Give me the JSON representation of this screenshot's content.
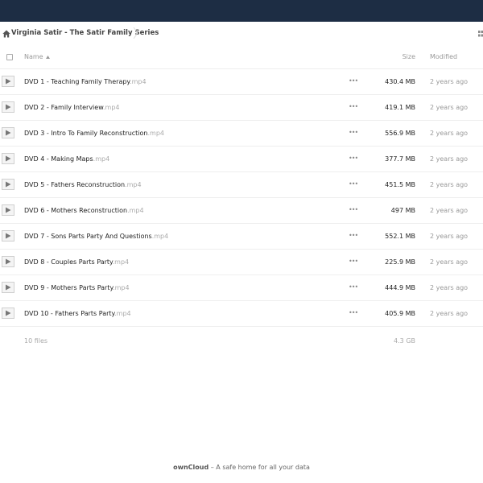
{
  "breadcrumb": {
    "icon": "home-icon",
    "path": "Virginia Satir - The Satir Family Series"
  },
  "table": {
    "headers": {
      "name": "Name",
      "size": "Size",
      "modified": "Modified"
    },
    "sort_icon": "sort-ascending-icon",
    "files": [
      {
        "name": "DVD 1 - Teaching Family Therapy",
        "ext": ".mp4",
        "size": "430.4 MB",
        "modified": "2 years ago"
      },
      {
        "name": "DVD 2 - Family Interview",
        "ext": ".mp4",
        "size": "419.1 MB",
        "modified": "2 years ago"
      },
      {
        "name": "DVD 3 - Intro To Family Reconstruction",
        "ext": ".mp4",
        "size": "556.9 MB",
        "modified": "2 years ago"
      },
      {
        "name": "DVD 4 - Making Maps",
        "ext": ".mp4",
        "size": "377.7 MB",
        "modified": "2 years ago"
      },
      {
        "name": "DVD 5 - Fathers Reconstruction",
        "ext": ".mp4",
        "size": "451.5 MB",
        "modified": "2 years ago"
      },
      {
        "name": "DVD 6 - Mothers Reconstruction",
        "ext": ".mp4",
        "size": "497 MB",
        "modified": "2 years ago"
      },
      {
        "name": "DVD 7 - Sons Parts Party And Questions",
        "ext": ".mp4",
        "size": "552.1 MB",
        "modified": "2 years ago"
      },
      {
        "name": "DVD 8 - Couples Parts Party",
        "ext": ".mp4",
        "size": "225.9 MB",
        "modified": "2 years ago"
      },
      {
        "name": "DVD 9 - Mothers Parts Party",
        "ext": ".mp4",
        "size": "444.9 MB",
        "modified": "2 years ago"
      },
      {
        "name": "DVD 10 - Fathers Parts Party",
        "ext": ".mp4",
        "size": "405.9 MB",
        "modified": "2 years ago"
      }
    ],
    "summary": {
      "count": "10 files",
      "total_size": "4.3 GB"
    }
  },
  "footer": {
    "brand": "ownCloud",
    "tagline": " – A safe home for all your data"
  },
  "colors": {
    "topbar": "#1d2d44",
    "muted_text": "#999999",
    "row_border": "#eeeeee"
  }
}
